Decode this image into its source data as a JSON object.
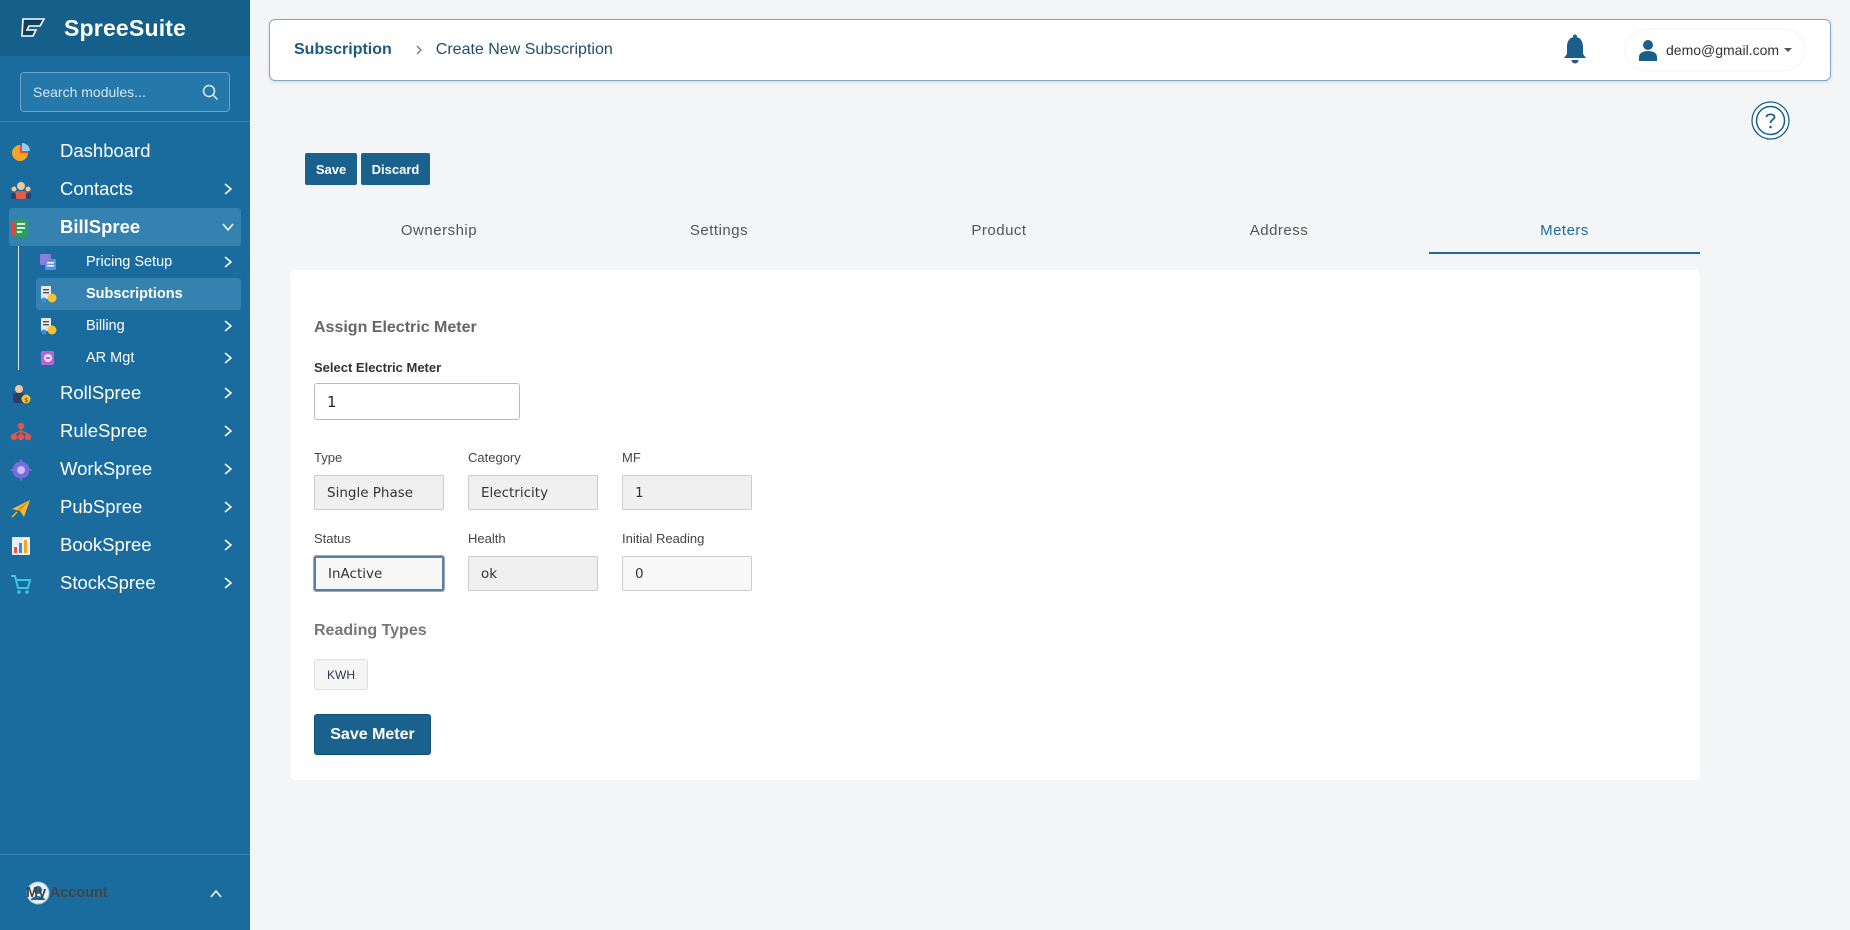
{
  "app": {
    "name": "SpreeSuite"
  },
  "sidebar": {
    "search_placeholder": "Search modules...",
    "items": [
      {
        "label": "Dashboard"
      },
      {
        "label": "Contacts"
      },
      {
        "label": "BillSpree"
      },
      {
        "label": "RollSpree"
      },
      {
        "label": "RuleSpree"
      },
      {
        "label": "WorkSpree"
      },
      {
        "label": "PubSpree"
      },
      {
        "label": "BookSpree"
      },
      {
        "label": "StockSpree"
      }
    ],
    "billspree_sub": [
      {
        "label": "Pricing Setup"
      },
      {
        "label": "Subscriptions"
      },
      {
        "label": "Billing"
      },
      {
        "label": "AR Mgt"
      }
    ],
    "account_label": "My Account"
  },
  "header": {
    "breadcrumb_main": "Subscription",
    "breadcrumb_current": "Create New Subscription",
    "user_email": "demo@gmail.com"
  },
  "actions": {
    "save": "Save",
    "discard": "Discard"
  },
  "tabs": [
    {
      "label": "Ownership"
    },
    {
      "label": "Settings"
    },
    {
      "label": "Product"
    },
    {
      "label": "Address"
    },
    {
      "label": "Meters"
    }
  ],
  "form": {
    "title": "Assign Electric Meter",
    "select_label": "Select Electric Meter",
    "select_value": "1",
    "type_label": "Type",
    "type_value": "Single Phase",
    "category_label": "Category",
    "category_value": "Electricity",
    "mf_label": "MF",
    "mf_value": "1",
    "status_label": "Status",
    "status_value": "InActive",
    "health_label": "Health",
    "health_value": "ok",
    "initial_label": "Initial Reading",
    "initial_value": "0",
    "reading_types_title": "Reading Types",
    "reading_type_chip": "KWH",
    "save_meter": "Save Meter"
  },
  "colors": {
    "primary": "#1a6c9e",
    "button": "#1b618e"
  }
}
